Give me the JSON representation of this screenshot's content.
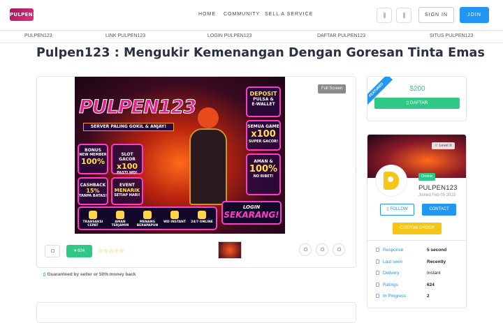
{
  "header": {
    "logo_text": "PULPEN123",
    "nav": [
      {
        "label": "HOME"
      },
      {
        "label": "COMMUNITY"
      },
      {
        "label": "SELL A SERVICE"
      }
    ],
    "signin_label": "SIGN IN",
    "join_label": "JOIN"
  },
  "subnav": [
    {
      "label": "PULPEN123"
    },
    {
      "label": "LINK PULPEN123"
    },
    {
      "label": "LOGIN PULPEN123"
    },
    {
      "label": "DAFTAR PULPEN123"
    },
    {
      "label": "SITUS PULPEN123"
    }
  ],
  "page_title": "Pulpen123 : Mengukir Kemenangan Dengan Goresan Tinta Emas",
  "banner": {
    "brand": "PULPEN123",
    "tagline": "SERVER PALING GOKIL & ANJAY!",
    "tiles": [
      {
        "line1": "BONUS",
        "line2": "100%",
        "line3": "NEW MEMBER"
      },
      {
        "line1": "SLOT GACOR",
        "line2": "x100",
        "line3": "PASTI WD!"
      },
      {
        "line1": "CASHBACK",
        "line2": "15%",
        "line3": "TANPA BATAS!"
      },
      {
        "line1": "EVENT",
        "line2": "MENARIK",
        "line3": "SETIAP HARI!"
      },
      {
        "line1": "DEPOSIT",
        "line2": "PULSA &",
        "line3": "E-WALLET"
      },
      {
        "line1": "SEMUA GAME",
        "line2": "x100",
        "line3": "SUPER GACOR!"
      },
      {
        "line1": "AMAN &",
        "line2": "100%",
        "line3": "NO RIBET!"
      }
    ],
    "login_line1": "LOGIN",
    "login_line2": "SEKARANG!",
    "features": [
      {
        "label": "TRANSAKSI CEPAT"
      },
      {
        "label": "AMAN TERJAMIN"
      },
      {
        "label": "MENANG BERAPAPUN"
      },
      {
        "label": "WD INSTANT"
      },
      {
        "label": "24/7 ONLINE"
      }
    ]
  },
  "gallery": {
    "fullscreen_label": "Full Screen",
    "like_count": "624",
    "rating_stars": "☆☆☆☆☆"
  },
  "guarantee_text": "Guaranteed by seller or 50% money back",
  "price_card": {
    "ribbon": "FEATURED",
    "price": "$200",
    "daftar_label": "DAFTAR"
  },
  "seller": {
    "level": "Level X",
    "status": "Online",
    "name": "PULPEN123",
    "joined": "Joined Feb 05 2015",
    "follow_label": "FOLLOW",
    "contact_label": "CONTACT",
    "custom_order_label": "CUSTOM ORDER",
    "stats": [
      {
        "key": "Response",
        "value": "5 second"
      },
      {
        "key": "Last seen",
        "value": "Recently"
      },
      {
        "key": "Delivery",
        "value": "Instant"
      },
      {
        "key": "Ratings",
        "value": "624"
      },
      {
        "key": "In Progress",
        "value": "2"
      }
    ]
  },
  "colors": {
    "accent_blue": "#2196f3",
    "accent_green": "#2fc987",
    "accent_yellow": "#f5c518",
    "title": "#2b3140"
  }
}
